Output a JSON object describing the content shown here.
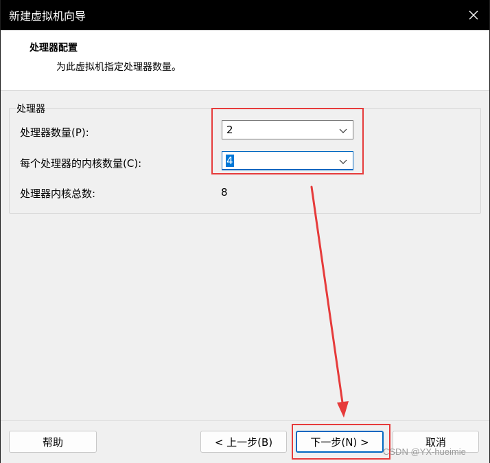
{
  "window": {
    "title": "新建虚拟机向导"
  },
  "header": {
    "title": "处理器配置",
    "subtitle": "为此虚拟机指定处理器数量。"
  },
  "group": {
    "legend": "处理器",
    "processors": {
      "label": "处理器数量(P):",
      "value": "2"
    },
    "cores": {
      "label": "每个处理器的内核数量(C):",
      "value": "4"
    },
    "total": {
      "label": "处理器内核总数:",
      "value": "8"
    }
  },
  "buttons": {
    "help": "帮助",
    "back": "< 上一步(B)",
    "next": "下一步(N) >",
    "cancel": "取消"
  },
  "watermark": "CSDN @YX-hueimie",
  "colors": {
    "highlight": "#e63b3b",
    "focus": "#0067c0",
    "titlebar": "#000000"
  }
}
